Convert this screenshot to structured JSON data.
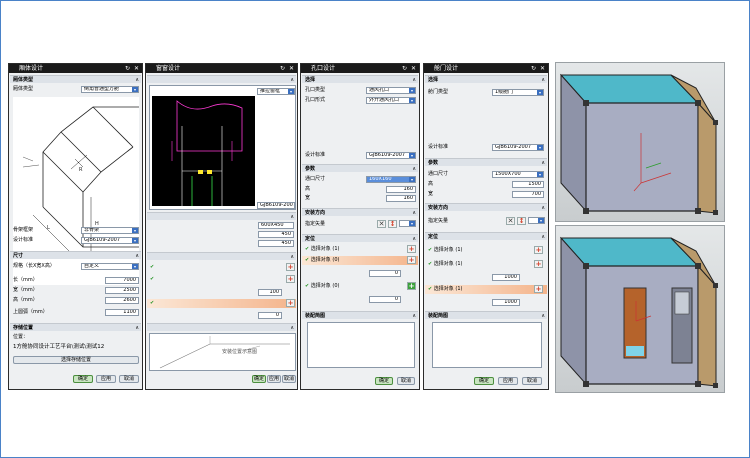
{
  "panel1": {
    "title": "厢体设计",
    "sections": {
      "type": "厢体类型",
      "size": "尺寸",
      "storage": "存储位置"
    },
    "type_label": "厢体类型",
    "type_value": "倒角普通型方舱",
    "skeleton_label": "骨架框架",
    "skeleton_value": "非骨架",
    "standard_label": "设计标准",
    "standard_value": "GJB6109-2007",
    "spec_label": "规格（长X宽X高）",
    "spec_value": "自定义",
    "length_label": "长（mm）",
    "length_value": "7000",
    "width_label": "宽（mm）",
    "width_value": "2500",
    "height_label": "高（mm）",
    "height_value": "2600",
    "top_label": "上圆弧（mm）",
    "top_value": "1100",
    "location_label": "位置：",
    "location_value": "1方舱协同设计工艺平台\\测试\\测试12",
    "select_button": "选择存储位置",
    "ok": "确定",
    "apply": "应用",
    "cancel": "取消"
  },
  "panel2": {
    "title": "窗窗设计",
    "select_option": "推拉窗框",
    "standard_value": "GJB6109-2007",
    "param_values": [
      "600X450",
      "450",
      "450"
    ],
    "offset_value": "100",
    "zero_value": "0",
    "preview_text": "安装位置示意图",
    "ok": "确定",
    "apply": "应用",
    "cancel": "取消"
  },
  "panel3": {
    "title": "孔口设计",
    "sections": {
      "select": "选择",
      "params": "参数",
      "direction": "安装方向",
      "position": "定位",
      "preview": "装配简图"
    },
    "hole_type_label": "孔口类型",
    "hole_type_value": "通风孔口",
    "hole_form_label": "孔口形式",
    "hole_form_value": "外开通风孔口",
    "standard_label": "设计标准",
    "standard_value": "GJB6109-2007",
    "size_label": "通口尺寸",
    "size_value": "160X160",
    "h_label": "高",
    "h_value": "160",
    "w_label": "宽",
    "w_value": "160",
    "vector_label": "指定矢量",
    "obj1": "选择对象 (1)",
    "obj2": "选择对象 (0)",
    "obj3": "选择对象 (0)",
    "val1": "0",
    "val2": "0",
    "ok": "确定",
    "cancel": "取消"
  },
  "panel4": {
    "title": "舱门设计",
    "sections": {
      "select": "选择",
      "params": "参数",
      "direction": "安装方向",
      "position": "定位",
      "preview": "装配简图"
    },
    "door_type_label": "舱门类型",
    "door_type_value": "1级舱门",
    "standard_label": "设计标准",
    "standard_value": "GJB6109-2007",
    "size_label": "通口尺寸",
    "size_value": "1500X700",
    "h_label": "高",
    "h_value": "1500",
    "w_label": "宽",
    "w_value": "700",
    "vector_label": "指定矢量",
    "obj1": "选择对象 (1)",
    "obj2": "选择对象 (1)",
    "obj3": "选择对象 (1)",
    "val1": "1000",
    "val2": "1000",
    "ok": "确定",
    "apply": "应用",
    "cancel": "取消"
  },
  "colors": {
    "roof": "#4fb8c9",
    "end_wall": "#b99a6b",
    "side_wall": "#a8adc2",
    "door": "#b5632b",
    "panel_bg": "#eef0f2",
    "title_bar": "#1a1a1a"
  }
}
